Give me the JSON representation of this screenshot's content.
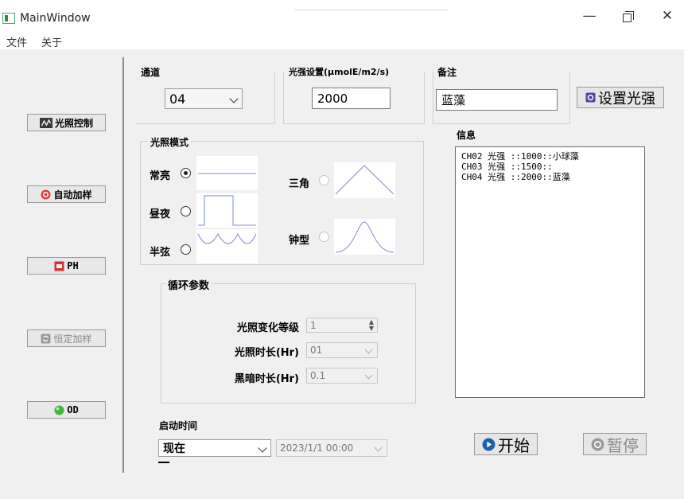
{
  "window": {
    "title": "MainWindow"
  },
  "menu": [
    "文件",
    "关于"
  ],
  "sidebar": [
    {
      "label": "光照控制",
      "icon": "wave-icon",
      "enabled": true
    },
    {
      "label": "自动加样",
      "icon": "target-icon",
      "enabled": true
    },
    {
      "label": "PH",
      "icon": "ph-icon",
      "enabled": true
    },
    {
      "label": "恒定加样",
      "icon": "refresh-icon",
      "enabled": false
    },
    {
      "label": "OD",
      "icon": "green-ball-icon",
      "enabled": true
    }
  ],
  "channel": {
    "label": "通道",
    "value": "04"
  },
  "light_setting": {
    "label": "光强设置(μmolE/m2/s)",
    "value": "2000"
  },
  "note": {
    "label": "备注",
    "value": "蓝藻"
  },
  "set_light_button": "设置光强",
  "light_mode": {
    "label": "光照模式",
    "options": [
      {
        "label": "常亮",
        "checked": true,
        "enabled": true
      },
      {
        "label": "昼夜",
        "checked": false,
        "enabled": true
      },
      {
        "label": "半弦",
        "checked": false,
        "enabled": true
      },
      {
        "label": "三角",
        "checked": false,
        "enabled": false
      },
      {
        "label": "钟型",
        "checked": false,
        "enabled": false
      }
    ]
  },
  "cycle": {
    "label": "循环参数",
    "level": {
      "label": "光照变化等级",
      "value": "1"
    },
    "light_duration": {
      "label": "光照时长(Hr)",
      "value": "01"
    },
    "dark_duration": {
      "label": "黑暗时长(Hr)",
      "value": "0.1"
    }
  },
  "start_time": {
    "label": "启动时间",
    "mode": "现在",
    "datetime": "2023/1/1 00:00"
  },
  "info": {
    "label": "信息",
    "lines": [
      "CH02 光强 ::1000::小球藻",
      "CH03 光强 ::1500::",
      "CH04 光强 ::2000::蓝藻"
    ]
  },
  "start_button": "开始",
  "pause_button": "暂停",
  "colors": {
    "accent": "#1e5fb4",
    "disabled": "#8a8a8a"
  }
}
